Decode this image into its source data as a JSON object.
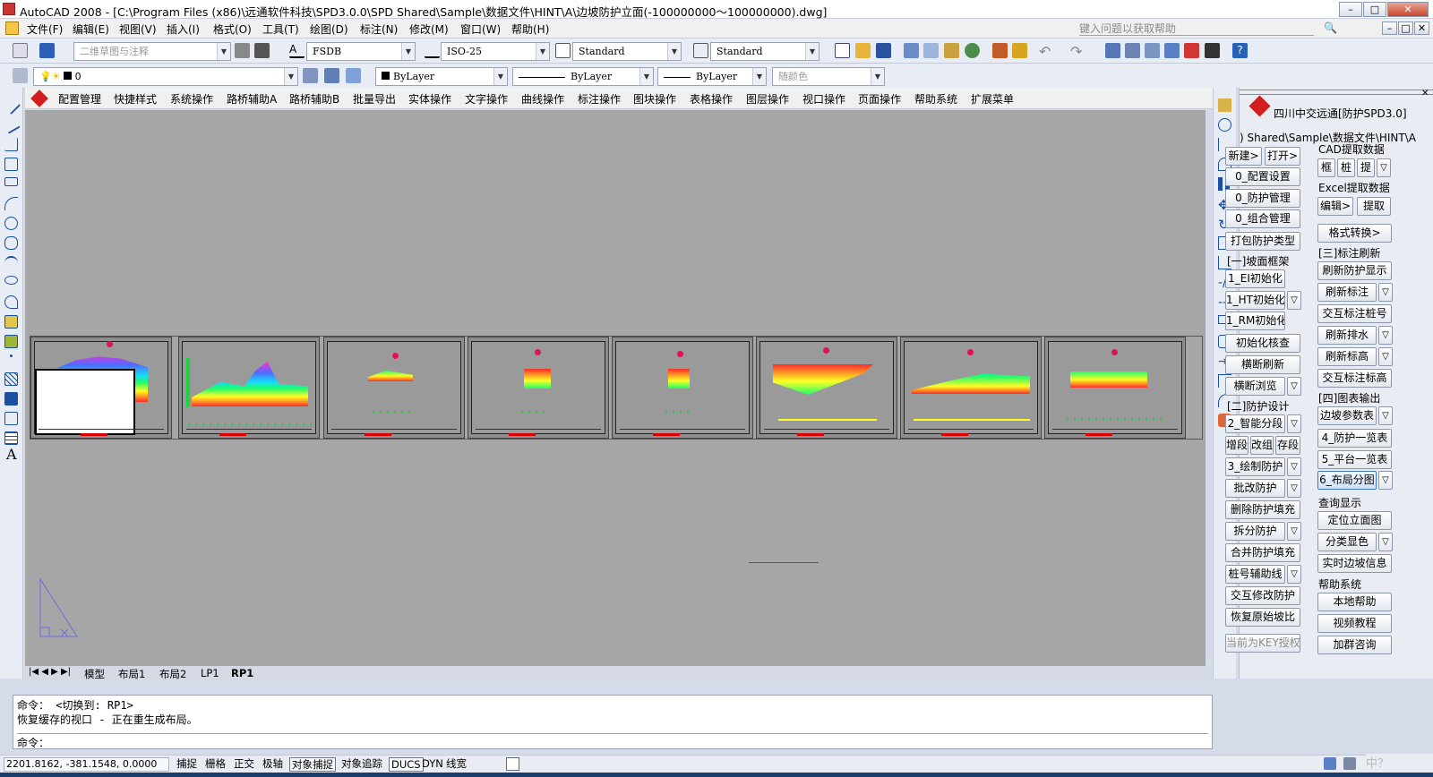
{
  "title": "AutoCAD 2008 - [C:\\Program Files (x86)\\远通软件科技\\SPD3.0.0\\SPD Shared\\Sample\\数据文件\\HINT\\A\\边坡防护立面(-100000000～100000000).dwg]",
  "window_buttons": {
    "min": "–",
    "max": "□",
    "close": "✕",
    "doc_min": "–",
    "doc_max": "□",
    "doc_close": "✕"
  },
  "menu": [
    "文件(F)",
    "编辑(E)",
    "视图(V)",
    "插入(I)",
    "格式(O)",
    "工具(T)",
    "绘图(D)",
    "标注(N)",
    "修改(M)",
    "窗口(W)",
    "帮助(H)"
  ],
  "help_search": {
    "placeholder": "键入问题以获取帮助"
  },
  "toolbar1": {
    "workspace": "二维草图与注释",
    "text_style": "FSDB",
    "dim_style": "ISO-25",
    "table_style": "Standard",
    "mleader_style": "Standard"
  },
  "toolbar2": {
    "layer": "0",
    "color": "ByLayer",
    "linetype": "ByLayer",
    "lineweight": "ByLayer",
    "plotstyle": "随颜色"
  },
  "custom_menu": [
    "配置管理",
    "快捷样式",
    "系统操作",
    "路桥辅助A",
    "路桥辅助B",
    "批量导出",
    "实体操作",
    "文字操作",
    "曲线操作",
    "标注操作",
    "图块操作",
    "表格操作",
    "图层操作",
    "视口操作",
    "页面操作",
    "帮助系统",
    "扩展菜单"
  ],
  "layout_tabs": [
    "模型",
    "布局1",
    "布局2",
    "LP1",
    "RP1"
  ],
  "command_lines": [
    "命令：  <切换到: RP1>",
    "恢复缓存的视口 - 正在重生成布局。",
    "命令："
  ],
  "status": {
    "coords": "2201.8162,  -381.1548,  0.0000",
    "buttons": [
      {
        "label": "捕捉",
        "on": false
      },
      {
        "label": "栅格",
        "on": false
      },
      {
        "label": "正交",
        "on": false
      },
      {
        "label": "极轴",
        "on": false
      },
      {
        "label": "对象捕捉",
        "on": true
      },
      {
        "label": "对象追踪",
        "on": false
      },
      {
        "label": "DUCS",
        "on": true
      },
      {
        "label": "DYN",
        "on": false
      },
      {
        "label": "线宽",
        "on": false
      }
    ]
  },
  "ime_text": "中？",
  "panel": {
    "header": "四川中交远通[防护SPD3.0]",
    "path": ") Shared\\Sample\\数据文件\\HINT\\A",
    "new_btn": "新建>",
    "open_btn": "打开>",
    "config_btn": "0_配置设置",
    "protect_mgr": "0_防护管理",
    "combo_mgr": "0_组合管理",
    "pack_btn": "打包防护类型",
    "sec1": "[一]坡面框架",
    "init_e": "1_EI初始化",
    "init_ht": "1_HT初始化",
    "init_rm": "1_RM初始化",
    "init_check": "初始化核查",
    "cross_refresh": "横断刷新",
    "cross_browse": "横断浏览",
    "sec2": "[二]防护设计",
    "smart_seg": "2_智能分段",
    "add_seg": "增段",
    "mod_group": "改组",
    "save_seg": "存段",
    "draw_protect": "3_绘制防护",
    "batch_mod": "批改防护",
    "del_fill": "删除防护填充",
    "split_protect": "拆分防护",
    "merge_fill": "合并防护填充",
    "station_aux": "桩号辅助线",
    "interactive_mod": "交互修改防护",
    "restore_slope": "恢复原始坡比",
    "license": "当前为KEY授权",
    "cad_extract": "CAD提取数据",
    "kuang": "框",
    "zhuang": "桩",
    "ti": "提",
    "excel_extract": "Excel提取数据",
    "edit_btn": "编辑>",
    "extract_btn": "提取",
    "format_convert": "格式转换>",
    "sec3": "[三]标注刷新",
    "refresh_display": "刷新防护显示",
    "refresh_dim": "刷新标注",
    "interactive_station": "交互标注桩号",
    "refresh_drain": "刷新排水",
    "refresh_elev": "刷新标高",
    "interactive_elev": "交互标注标高",
    "sec4": "[四]图表输出",
    "slope_table": "边坡参数表",
    "protect_list": "4_防护一览表",
    "platform_list": "5_平台一览表",
    "layout_sheet": "6_布局分图",
    "query_display": "查询显示",
    "locate_elev": "定位立面图",
    "classify_color": "分类显色",
    "realtime_info": "实时边坡信息",
    "help_sys": "帮助系统",
    "local_help": "本地帮助",
    "video": "视频教程",
    "qq": "加群咨询",
    "dropdown": "▽",
    "close_x": "✕"
  },
  "icons": [
    "autocad-logo-icon",
    "qnew-icon",
    "open-icon",
    "save-icon",
    "plot-icon",
    "undo-icon",
    "redo-icon",
    "pan-icon",
    "zoom-icon",
    "layer-icon",
    "line-icon",
    "circle-icon",
    "arc-icon",
    "move-icon",
    "rotate-icon",
    "scale-icon",
    "text-icon",
    "help-icon",
    "ucs-icon"
  ]
}
